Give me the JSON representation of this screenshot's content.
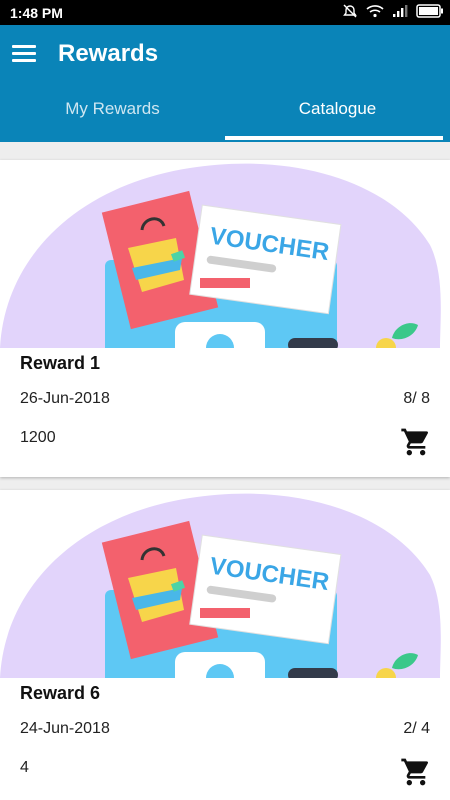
{
  "status_bar": {
    "time": "1:48 PM"
  },
  "app_bar": {
    "title": "Rewards"
  },
  "tabs": [
    {
      "label": "My Rewards",
      "selected": false
    },
    {
      "label": "Catalogue",
      "selected": true
    }
  ],
  "colors": {
    "primary": "#0a84b8",
    "illustration_bg": "#e2d4fb",
    "voucher_accent": "#3aa6e6"
  },
  "rewards": [
    {
      "title": "Reward 1",
      "date": "26-Jun-2018",
      "count": "8/ 8",
      "points": "1200",
      "image_text": "VOUCHER"
    },
    {
      "title": "Reward 6",
      "date": "24-Jun-2018",
      "count": "2/ 4",
      "points": "4",
      "image_text": "VOUCHER"
    }
  ]
}
